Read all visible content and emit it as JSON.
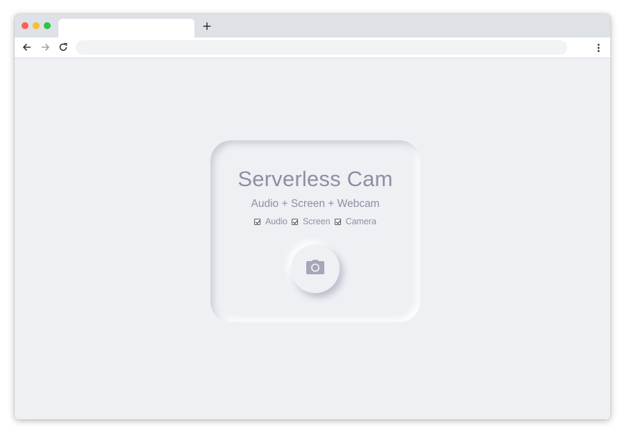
{
  "browser": {
    "tab_title": "",
    "new_tab_label": "+",
    "address": ""
  },
  "app": {
    "title": "Serverless Cam",
    "subtitle": "Audio + Screen + Webcam",
    "options": [
      {
        "label": "Audio",
        "checked": true
      },
      {
        "label": "Screen",
        "checked": true
      },
      {
        "label": "Camera",
        "checked": true
      }
    ],
    "record_icon": "camera-icon"
  },
  "colors": {
    "background": "#eef0f4",
    "text": "#8b90a3",
    "icon": "#a3a7b8"
  }
}
